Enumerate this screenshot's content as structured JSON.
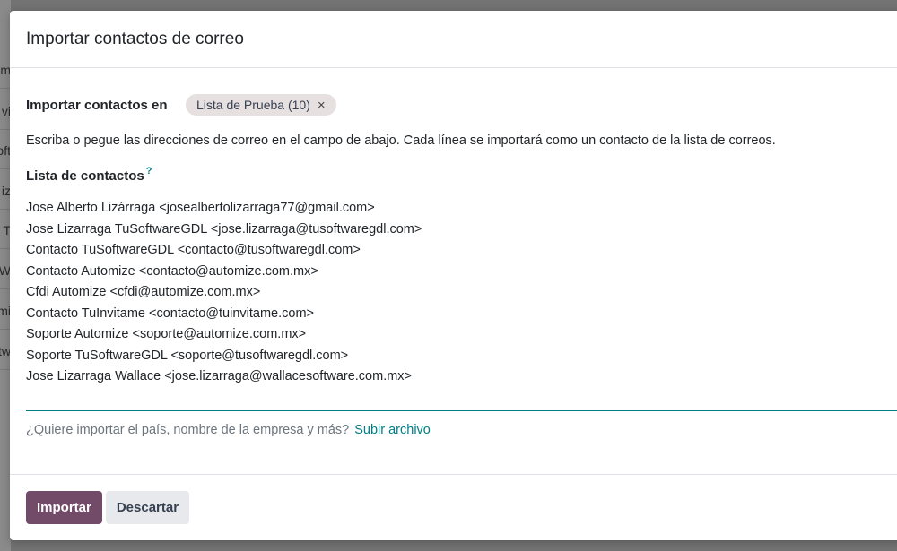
{
  "background": {
    "rows": [
      "om",
      "vi",
      "oft",
      "iz",
      "T",
      "W",
      "mi",
      "tw"
    ]
  },
  "dialog": {
    "title": "Importar contactos de correo",
    "list_field_label": "Importar contactos en",
    "list_tag": "Lista de Prueba (10)",
    "tag_remove_icon": "×",
    "instructions": "Escriba o pegue las direcciones de correo en el campo de abajo. Cada línea se importará como un contacto de la lista de correos.",
    "contacts_label": "Lista de contactos",
    "contacts_help_marker": "?",
    "contacts": [
      "Jose Alberto Lizárraga <josealbertolizarraga77@gmail.com>",
      "Jose Lizarraga TuSoftwareGDL <jose.lizarraga@tusoftwaregdl.com>",
      "Contacto TuSoftwareGDL <contacto@tusoftwaregdl.com>",
      "Contacto Automize <contacto@automize.com.mx>",
      "Cfdi Automize <cfdi@automize.com.mx>",
      "Contacto TuInvitame <contacto@tuinvitame.com>",
      "Soporte Automize <soporte@automize.com.mx>",
      "Soporte TuSoftwareGDL <soporte@tusoftwaregdl.com>",
      "Jose Lizarraga Wallace <jose.lizarraga@wallacesoftware.com.mx>"
    ],
    "import_hint": "¿Quiere importar el país, nombre de la empresa y más?",
    "import_link": "Subir archivo",
    "buttons": {
      "import": "Importar",
      "discard": "Descartar"
    }
  },
  "colors": {
    "primary": "#714b67",
    "link": "#017e84",
    "tag_bg": "#e7e0e0"
  }
}
